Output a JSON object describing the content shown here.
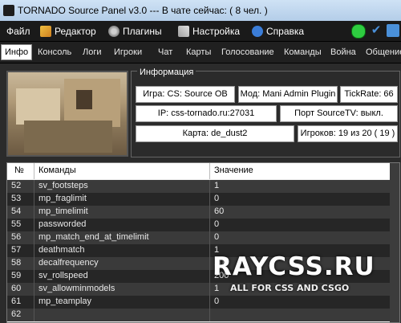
{
  "window": {
    "title": "TORNADO Source Panel v3.0 --- В чате сейчас: ( 8 чел. )"
  },
  "menu": [
    {
      "label": "Файл",
      "icon": "none"
    },
    {
      "label": "Редактор",
      "icon": "brush-icon"
    },
    {
      "label": "Плагины",
      "icon": "gears-icon"
    },
    {
      "label": "Настройка",
      "icon": "tools-icon"
    },
    {
      "label": "Справка",
      "icon": "help-icon"
    }
  ],
  "status_icons": [
    {
      "name": "status-green-icon",
      "color": "#2ecc40"
    },
    {
      "name": "check-icon",
      "color": "#4a90d9"
    },
    {
      "name": "network-icon",
      "color": "#4a90d9"
    }
  ],
  "tabs": [
    {
      "label": "Инфо",
      "active": true
    },
    {
      "label": "Консоль"
    },
    {
      "label": "Логи"
    },
    {
      "label": "Игроки"
    },
    {
      "label": "Чат"
    },
    {
      "label": "Карты"
    },
    {
      "label": "Голосование"
    },
    {
      "label": "Команды"
    },
    {
      "label": "Война"
    },
    {
      "label": "Общение"
    }
  ],
  "info": {
    "title": "Информация",
    "game": "Игра: CS: Source OB",
    "mod": "Мод: Mani Admin Plugin",
    "tickrate": "TickRate: 66",
    "ip": "IP: css-tornado.ru:27031",
    "sourcetv": "Порт SourceTV:  выкл.",
    "map": "Карта: de_dust2",
    "players": "Игроков: 19 из 20 ( 19 )"
  },
  "table": {
    "headers": [
      "№",
      "Команды",
      "Значение"
    ],
    "rows": [
      {
        "num": "52",
        "cmd": "sv_footsteps",
        "val": "1"
      },
      {
        "num": "53",
        "cmd": "mp_fraglimit",
        "val": "0"
      },
      {
        "num": "54",
        "cmd": "mp_timelimit",
        "val": "60"
      },
      {
        "num": "55",
        "cmd": "passworded",
        "val": "0"
      },
      {
        "num": "56",
        "cmd": "mp_match_end_at_timelimit",
        "val": "0"
      },
      {
        "num": "57",
        "cmd": "deathmatch",
        "val": "1"
      },
      {
        "num": "58",
        "cmd": "decalfrequency",
        "val": "10"
      },
      {
        "num": "59",
        "cmd": "sv_rollspeed",
        "val": "200"
      },
      {
        "num": "60",
        "cmd": "sv_allowminmodels",
        "val": "1"
      },
      {
        "num": "61",
        "cmd": "mp_teamplay",
        "val": "0"
      },
      {
        "num": "62",
        "cmd": "",
        "val": ""
      }
    ]
  },
  "watermark": {
    "title": "RAYCSS.RU",
    "subtitle": "ALL FOR CSS AND CSGO"
  }
}
